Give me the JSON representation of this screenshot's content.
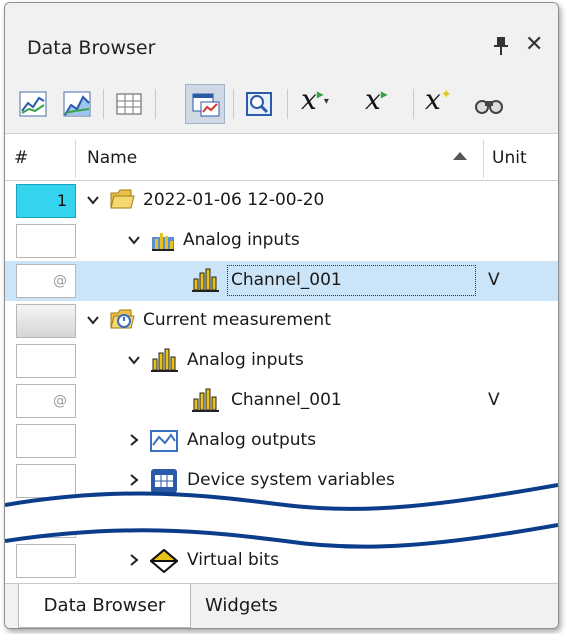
{
  "window": {
    "title": "Data Browser"
  },
  "toolbar": {
    "buttons": [
      "line-chart-icon",
      "area-chart-icon",
      "table-icon",
      "split-view-icon",
      "zoom-icon",
      "formula-dropdown-icon",
      "formula-icon",
      "new-variable-icon",
      "link-icon"
    ]
  },
  "columns": {
    "number": "#",
    "name": "Name",
    "unit": "Unit"
  },
  "rows": [
    {
      "num": "1",
      "label": "2022-01-06 12-00-20",
      "unit": ""
    },
    {
      "num": "",
      "label": "Analog inputs",
      "unit": ""
    },
    {
      "num": "@",
      "label": "Channel_001",
      "unit": "V"
    },
    {
      "num": "",
      "label": "Current measurement",
      "unit": ""
    },
    {
      "num": "",
      "label": "Analog inputs",
      "unit": ""
    },
    {
      "num": "@",
      "label": "Channel_001",
      "unit": "V"
    },
    {
      "num": "",
      "label": "Analog outputs",
      "unit": ""
    },
    {
      "num": "",
      "label": "Device system variables",
      "unit": ""
    },
    {
      "num": "",
      "label": "Virtual bits",
      "unit": ""
    }
  ],
  "tabs": {
    "active": "Data Browser",
    "other": "Widgets"
  },
  "colors": {
    "selected_row": "#cce4f7",
    "index_cyan": "#35d3ee",
    "wave": "#0b3d8c"
  }
}
